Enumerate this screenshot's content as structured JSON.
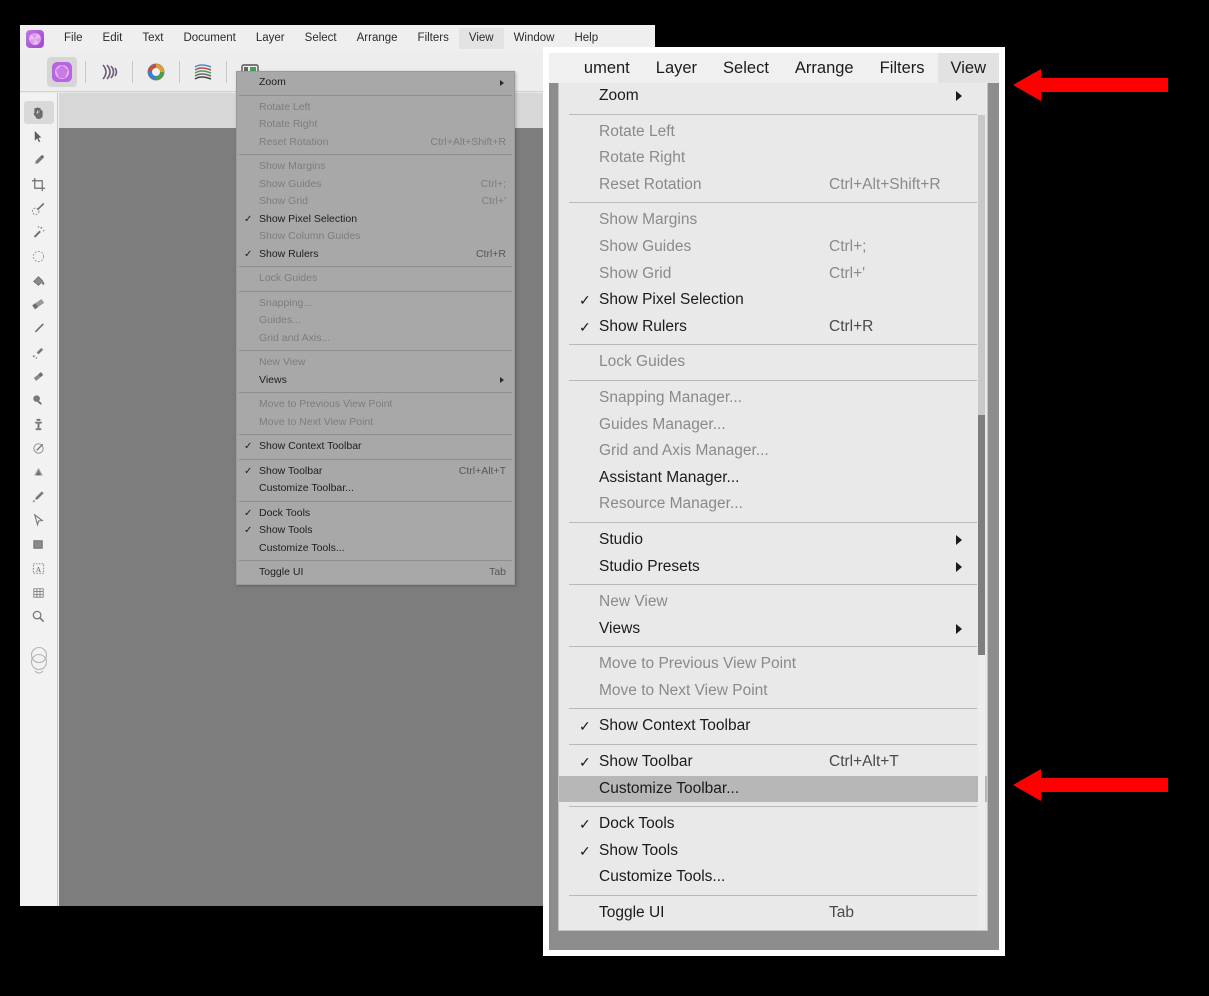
{
  "app": {
    "name": "Affinity Photo",
    "logo_icon": "affinity-photo-logo-icon",
    "menubar": [
      {
        "label": "File",
        "active": false
      },
      {
        "label": "Edit",
        "active": false
      },
      {
        "label": "Text",
        "active": false
      },
      {
        "label": "Document",
        "active": false
      },
      {
        "label": "Layer",
        "active": false
      },
      {
        "label": "Select",
        "active": false
      },
      {
        "label": "Arrange",
        "active": false
      },
      {
        "label": "Filters",
        "active": false
      },
      {
        "label": "View",
        "active": true
      },
      {
        "label": "Window",
        "active": false
      },
      {
        "label": "Help",
        "active": false
      }
    ],
    "toolbar_personas": [
      {
        "name": "photo-persona-icon",
        "selected": true
      },
      {
        "name": "liquify-persona-icon",
        "selected": false
      },
      {
        "name": "develop-persona-icon",
        "selected": false
      },
      {
        "name": "tone-mapping-persona-icon",
        "selected": false
      },
      {
        "name": "export-persona-icon",
        "selected": false
      }
    ],
    "tools": [
      {
        "name": "view-hand-tool",
        "selected": true
      },
      {
        "name": "move-tool",
        "selected": false
      },
      {
        "name": "color-picker-tool",
        "selected": false
      },
      {
        "name": "crop-tool",
        "selected": false
      },
      {
        "name": "selection-brush-tool",
        "selected": false
      },
      {
        "name": "flood-select-tool",
        "selected": false
      },
      {
        "name": "elliptical-marquee-tool",
        "selected": false
      },
      {
        "name": "flood-fill-tool",
        "selected": false
      },
      {
        "name": "gradient-tool",
        "selected": false
      },
      {
        "name": "paint-brush-tool",
        "selected": false
      },
      {
        "name": "pixel-tool",
        "selected": false
      },
      {
        "name": "erase-brush-tool",
        "selected": false
      },
      {
        "name": "dodge-brush-tool",
        "selected": false
      },
      {
        "name": "clone-brush-tool",
        "selected": false
      },
      {
        "name": "smudge-brush-tool",
        "selected": false
      },
      {
        "name": "sharpen-brush-tool",
        "selected": false
      },
      {
        "name": "blur-brush-tool",
        "selected": false
      },
      {
        "name": "pen-tool",
        "selected": false
      },
      {
        "name": "rectangle-tool",
        "selected": false
      },
      {
        "name": "artistic-text-tool",
        "selected": false
      },
      {
        "name": "mesh-warp-tool",
        "selected": false
      },
      {
        "name": "zoom-tool",
        "selected": false
      }
    ]
  },
  "small_menu": {
    "title": "View",
    "items": [
      {
        "label": "Zoom",
        "shortcut": "",
        "checked": false,
        "enabled": true,
        "submenu": true
      },
      {
        "separator": true
      },
      {
        "label": "Rotate Left",
        "shortcut": "",
        "checked": false,
        "enabled": false,
        "submenu": false
      },
      {
        "label": "Rotate Right",
        "shortcut": "",
        "checked": false,
        "enabled": false,
        "submenu": false
      },
      {
        "label": "Reset Rotation",
        "shortcut": "Ctrl+Alt+Shift+R",
        "checked": false,
        "enabled": false,
        "submenu": false
      },
      {
        "separator": true
      },
      {
        "label": "Show Margins",
        "shortcut": "",
        "checked": false,
        "enabled": false,
        "submenu": false
      },
      {
        "label": "Show Guides",
        "shortcut": "Ctrl+;",
        "checked": false,
        "enabled": false,
        "submenu": false
      },
      {
        "label": "Show Grid",
        "shortcut": "Ctrl+'",
        "checked": false,
        "enabled": false,
        "submenu": false
      },
      {
        "label": "Show Pixel Selection",
        "shortcut": "",
        "checked": true,
        "enabled": true,
        "submenu": false
      },
      {
        "label": "Show Column Guides",
        "shortcut": "",
        "checked": false,
        "enabled": false,
        "submenu": false
      },
      {
        "label": "Show Rulers",
        "shortcut": "Ctrl+R",
        "checked": true,
        "enabled": true,
        "submenu": false
      },
      {
        "separator": true
      },
      {
        "label": "Lock Guides",
        "shortcut": "",
        "checked": false,
        "enabled": false,
        "submenu": false
      },
      {
        "separator": true
      },
      {
        "label": "Snapping...",
        "shortcut": "",
        "checked": false,
        "enabled": false,
        "submenu": false
      },
      {
        "label": "Guides...",
        "shortcut": "",
        "checked": false,
        "enabled": false,
        "submenu": false
      },
      {
        "label": "Grid and Axis...",
        "shortcut": "",
        "checked": false,
        "enabled": false,
        "submenu": false
      },
      {
        "separator": true
      },
      {
        "label": "New View",
        "shortcut": "",
        "checked": false,
        "enabled": false,
        "submenu": false
      },
      {
        "label": "Views",
        "shortcut": "",
        "checked": false,
        "enabled": true,
        "submenu": true
      },
      {
        "separator": true
      },
      {
        "label": "Move to Previous View Point",
        "shortcut": "",
        "checked": false,
        "enabled": false,
        "submenu": false
      },
      {
        "label": "Move to Next View Point",
        "shortcut": "",
        "checked": false,
        "enabled": false,
        "submenu": false
      },
      {
        "separator": true
      },
      {
        "label": "Show Context Toolbar",
        "shortcut": "",
        "checked": true,
        "enabled": true,
        "submenu": false
      },
      {
        "separator": true
      },
      {
        "label": "Show Toolbar",
        "shortcut": "Ctrl+Alt+T",
        "checked": true,
        "enabled": true,
        "submenu": false
      },
      {
        "label": "Customize Toolbar...",
        "shortcut": "",
        "checked": false,
        "enabled": true,
        "submenu": false
      },
      {
        "separator": true
      },
      {
        "label": "Dock Tools",
        "shortcut": "",
        "checked": true,
        "enabled": true,
        "submenu": false
      },
      {
        "label": "Show Tools",
        "shortcut": "",
        "checked": true,
        "enabled": true,
        "submenu": false
      },
      {
        "label": "Customize Tools...",
        "shortcut": "",
        "checked": false,
        "enabled": true,
        "submenu": false
      },
      {
        "separator": true
      },
      {
        "label": "Toggle UI",
        "shortcut": "Tab",
        "checked": false,
        "enabled": true,
        "submenu": false
      }
    ]
  },
  "zoom_panel": {
    "menubar": [
      {
        "label": "ument",
        "active": false
      },
      {
        "label": "Layer",
        "active": false
      },
      {
        "label": "Select",
        "active": false
      },
      {
        "label": "Arrange",
        "active": false
      },
      {
        "label": "Filters",
        "active": false
      },
      {
        "label": "View",
        "active": true
      }
    ],
    "items": [
      {
        "label": "Zoom",
        "shortcut": "",
        "checked": false,
        "enabled": true,
        "submenu": true,
        "highlight": false
      },
      {
        "separator": true
      },
      {
        "label": "Rotate Left",
        "shortcut": "",
        "checked": false,
        "enabled": false,
        "submenu": false,
        "highlight": false
      },
      {
        "label": "Rotate Right",
        "shortcut": "",
        "checked": false,
        "enabled": false,
        "submenu": false,
        "highlight": false
      },
      {
        "label": "Reset Rotation",
        "shortcut": "Ctrl+Alt+Shift+R",
        "checked": false,
        "enabled": false,
        "submenu": false,
        "highlight": false
      },
      {
        "separator": true
      },
      {
        "label": "Show Margins",
        "shortcut": "",
        "checked": false,
        "enabled": false,
        "submenu": false,
        "highlight": false
      },
      {
        "label": "Show Guides",
        "shortcut": "Ctrl+;",
        "checked": false,
        "enabled": false,
        "submenu": false,
        "highlight": false
      },
      {
        "label": "Show Grid",
        "shortcut": "Ctrl+'",
        "checked": false,
        "enabled": false,
        "submenu": false,
        "highlight": false
      },
      {
        "label": "Show Pixel Selection",
        "shortcut": "",
        "checked": true,
        "enabled": true,
        "submenu": false,
        "highlight": false
      },
      {
        "label": "Show Rulers",
        "shortcut": "Ctrl+R",
        "checked": true,
        "enabled": true,
        "submenu": false,
        "highlight": false
      },
      {
        "separator": true
      },
      {
        "label": "Lock Guides",
        "shortcut": "",
        "checked": false,
        "enabled": false,
        "submenu": false,
        "highlight": false
      },
      {
        "separator": true
      },
      {
        "label": "Snapping Manager...",
        "shortcut": "",
        "checked": false,
        "enabled": false,
        "submenu": false,
        "highlight": false
      },
      {
        "label": "Guides Manager...",
        "shortcut": "",
        "checked": false,
        "enabled": false,
        "submenu": false,
        "highlight": false
      },
      {
        "label": "Grid and Axis Manager...",
        "shortcut": "",
        "checked": false,
        "enabled": false,
        "submenu": false,
        "highlight": false
      },
      {
        "label": "Assistant Manager...",
        "shortcut": "",
        "checked": false,
        "enabled": true,
        "submenu": false,
        "highlight": false
      },
      {
        "label": "Resource Manager...",
        "shortcut": "",
        "checked": false,
        "enabled": false,
        "submenu": false,
        "highlight": false
      },
      {
        "separator": true
      },
      {
        "label": "Studio",
        "shortcut": "",
        "checked": false,
        "enabled": true,
        "submenu": true,
        "highlight": false
      },
      {
        "label": "Studio Presets",
        "shortcut": "",
        "checked": false,
        "enabled": true,
        "submenu": true,
        "highlight": false
      },
      {
        "separator": true
      },
      {
        "label": "New View",
        "shortcut": "",
        "checked": false,
        "enabled": false,
        "submenu": false,
        "highlight": false
      },
      {
        "label": "Views",
        "shortcut": "",
        "checked": false,
        "enabled": true,
        "submenu": true,
        "highlight": false
      },
      {
        "separator": true
      },
      {
        "label": "Move to Previous View Point",
        "shortcut": "",
        "checked": false,
        "enabled": false,
        "submenu": false,
        "highlight": false
      },
      {
        "label": "Move to Next View Point",
        "shortcut": "",
        "checked": false,
        "enabled": false,
        "submenu": false,
        "highlight": false
      },
      {
        "separator": true
      },
      {
        "label": "Show Context Toolbar",
        "shortcut": "",
        "checked": true,
        "enabled": true,
        "submenu": false,
        "highlight": false
      },
      {
        "separator": true
      },
      {
        "label": "Show Toolbar",
        "shortcut": "Ctrl+Alt+T",
        "checked": true,
        "enabled": true,
        "submenu": false,
        "highlight": false
      },
      {
        "label": "Customize Toolbar...",
        "shortcut": "",
        "checked": false,
        "enabled": true,
        "submenu": false,
        "highlight": true
      },
      {
        "separator": true
      },
      {
        "label": "Dock Tools",
        "shortcut": "",
        "checked": true,
        "enabled": true,
        "submenu": false,
        "highlight": false
      },
      {
        "label": "Show Tools",
        "shortcut": "",
        "checked": true,
        "enabled": true,
        "submenu": false,
        "highlight": false
      },
      {
        "label": "Customize Tools...",
        "shortcut": "",
        "checked": false,
        "enabled": true,
        "submenu": false,
        "highlight": false
      },
      {
        "separator": true
      },
      {
        "label": "Toggle UI",
        "shortcut": "Tab",
        "checked": false,
        "enabled": true,
        "submenu": false,
        "highlight": false
      }
    ]
  },
  "annotations": [
    {
      "name": "arrow-pointing-to-view-menu",
      "color": "#ff0000",
      "target": "View"
    },
    {
      "name": "arrow-pointing-to-customize-toolbar",
      "color": "#ff0000",
      "target": "Customize Toolbar..."
    }
  ],
  "checkmark_glyph": "✓",
  "colors": {
    "annotation_red": "#ff0000",
    "menu_highlight": "#b7b7b7",
    "background": "#000000",
    "app_chrome": "#efefef",
    "canvas": "#7d7d7d"
  }
}
